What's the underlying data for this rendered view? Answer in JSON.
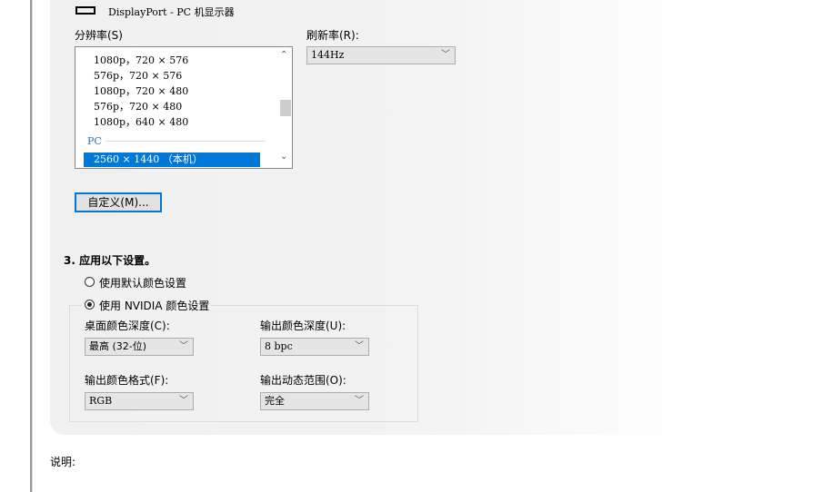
{
  "display": {
    "connector_icon": "displayport-icon",
    "name": "DisplayPort - PC 机显示器"
  },
  "resolution": {
    "label": "分辨率(S)",
    "items": [
      "1080p，720 × 576",
      "576p，720 × 576",
      "1080p，720 × 480",
      "576p，720 × 480",
      "1080p，640 × 480"
    ],
    "group_label": "PC",
    "selected": "2560 × 1440 （本机）"
  },
  "refresh": {
    "label": "刷新率(R):",
    "value": "144Hz"
  },
  "custom_button": "自定义(M)...",
  "step3": {
    "title": "3. 应用以下设置。",
    "radio_default": "使用默认颜色设置",
    "radio_nvidia": "使用 NVIDIA 颜色设置",
    "desktop_depth": {
      "label": "桌面颜色深度(C):",
      "value": "最高 (32-位)"
    },
    "output_depth": {
      "label": "输出颜色深度(U):",
      "value": "8 bpc"
    },
    "output_format": {
      "label": "输出颜色格式(F):",
      "value": "RGB"
    },
    "output_range": {
      "label": "输出动态范围(O):",
      "value": "完全"
    }
  },
  "description_label": "说明:"
}
